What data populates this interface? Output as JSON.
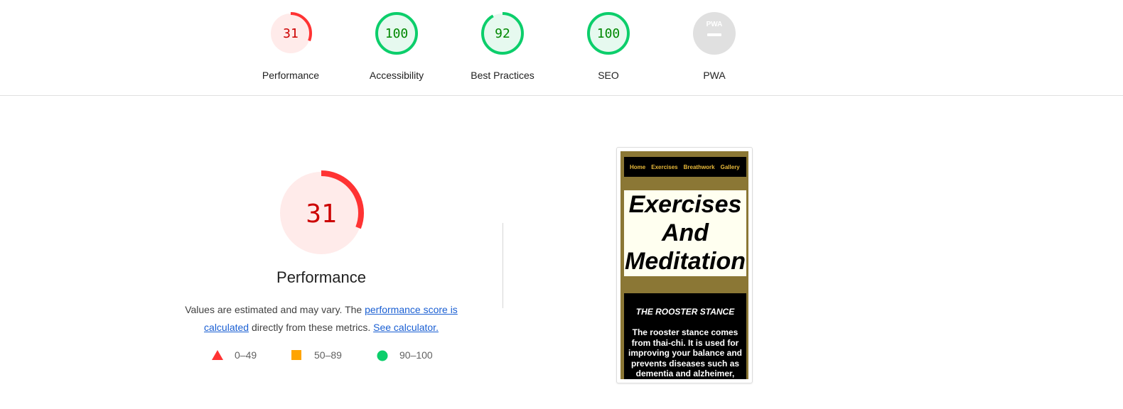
{
  "colors": {
    "fail": "#ff3333",
    "fail_bg": "#ffebea",
    "fail_text": "#cc0000",
    "pass": "#0cce6b",
    "pass_bg": "#e6f9ef",
    "pass_text": "#008800",
    "average": "#ffa400",
    "na": "#e0e0e0"
  },
  "top_gauges": [
    {
      "label": "Performance",
      "score": 31
    },
    {
      "label": "Accessibility",
      "score": 100
    },
    {
      "label": "Best Practices",
      "score": 92
    },
    {
      "label": "SEO",
      "score": 100
    },
    {
      "label": "PWA",
      "score": null,
      "badge": "PWA"
    }
  ],
  "main": {
    "score": 31,
    "title": "Performance",
    "desc_prefix": "Values are estimated and may vary. The ",
    "desc_link1": "performance score is calculated",
    "desc_middle": " directly from these metrics. ",
    "desc_link2": "See calculator."
  },
  "legend": [
    {
      "shape": "triangle-icon",
      "range": "0–49"
    },
    {
      "shape": "square-icon",
      "range": "50–89"
    },
    {
      "shape": "circle-icon",
      "range": "90–100"
    }
  ],
  "screenshot": {
    "nav": [
      "Home",
      "Exercises",
      "Breathwork",
      "Gallery"
    ],
    "hero": "Exercises And Meditation",
    "card_heading": "THE ROOSTER STANCE",
    "card_text": "The rooster stance comes from thai-chi. It is used for improving your balance and prevents diseases such as dementia and alzheimer,"
  }
}
